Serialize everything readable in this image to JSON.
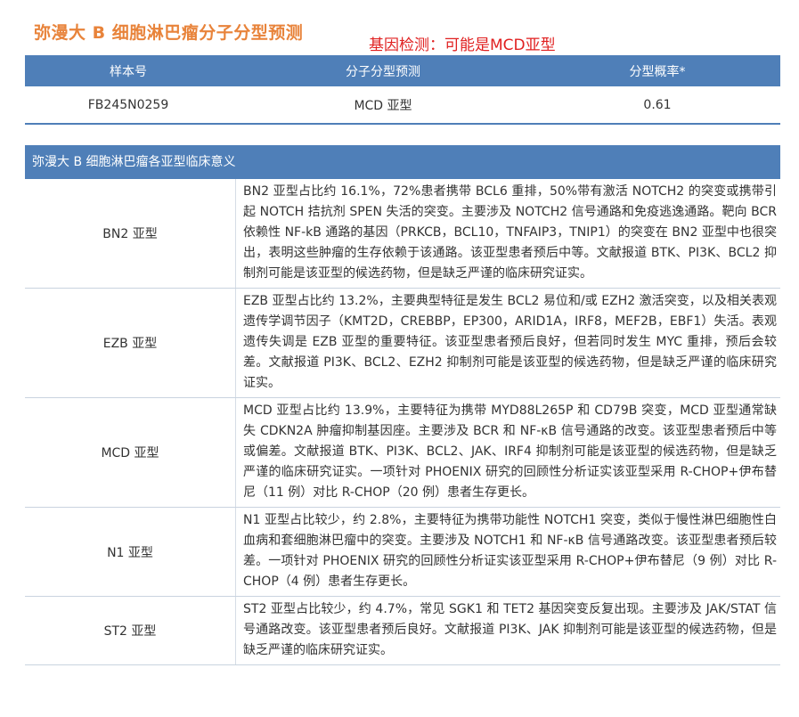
{
  "header": {
    "title": "弥漫大 B 细胞淋巴瘤分子分型预测",
    "gene_note": "基因检测：可能是MCD亚型"
  },
  "prediction_table": {
    "columns": [
      "样本号",
      "分子分型预测",
      "分型概率*"
    ],
    "row": [
      "FB245N0259",
      "MCD 亚型",
      "0.61"
    ]
  },
  "clinical": {
    "title": "弥漫大 B 细胞淋巴瘤各亚型临床意义",
    "rows": [
      {
        "type": "BN2 亚型",
        "desc": "BN2 亚型占比约 16.1%，72%患者携带 BCL6 重排，50%带有激活 NOTCH2 的突变或携带引起 NOTCH 拮抗剂 SPEN 失活的突变。主要涉及 NOTCH2 信号通路和免疫逃逸通路。靶向 BCR 依赖性 NF-kB 通路的基因（PRKCB，BCL10，TNFAIP3，TNIP1）的突变在 BN2 亚型中也很突出，表明这些肿瘤的生存依赖于该通路。该亚型患者预后中等。文献报道 BTK、PI3K、BCL2 抑制剂可能是该亚型的候选药物，但是缺乏严谨的临床研究证实。"
      },
      {
        "type": "EZB 亚型",
        "desc": "EZB 亚型占比约 13.2%，主要典型特征是发生 BCL2 易位和/或 EZH2 激活突变，以及相关表观遗传学调节因子（KMT2D，CREBBP，EP300，ARID1A，IRF8，MEF2B，EBF1）失活。表观遗传失调是 EZB 亚型的重要特征。该亚型患者预后良好，但若同时发生 MYC 重排，预后会较差。文献报道 PI3K、BCL2、EZH2 抑制剂可能是该亚型的候选药物，但是缺乏严谨的临床研究证实。"
      },
      {
        "type": "MCD 亚型",
        "desc": "MCD 亚型占比约 13.9%，主要特征为携带 MYD88L265P 和 CD79B 突变，MCD 亚型通常缺失 CDKN2A 肿瘤抑制基因座。主要涉及 BCR 和 NF-κB 信号通路的改变。该亚型患者预后中等或偏差。文献报道 BTK、PI3K、BCL2、JAK、IRF4 抑制剂可能是该亚型的候选药物，但是缺乏严谨的临床研究证实。一项针对 PHOENIX 研究的回顾性分析证实该亚型采用 R-CHOP+伊布替尼（11 例）对比 R-CHOP（20 例）患者生存更长。"
      },
      {
        "type": "N1 亚型",
        "desc": "N1 亚型占比较少，约 2.8%，主要特征为携带功能性 NOTCH1 突变，类似于慢性淋巴细胞性白血病和套细胞淋巴瘤中的突变。主要涉及 NOTCH1 和 NF-κB 信号通路改变。该亚型患者预后较差。一项针对 PHOENIX 研究的回顾性分析证实该亚型采用 R-CHOP+伊布替尼（9 例）对比 R-CHOP（4 例）患者生存更长。"
      },
      {
        "type": "ST2 亚型",
        "desc": "ST2 亚型占比较少，约 4.7%，常见 SGK1 和 TET2 基因突变反复出现。主要涉及 JAK/STAT 信号通路改变。该亚型患者预后良好。文献报道 PI3K、JAK 抑制剂可能是该亚型的候选药物，但是缺乏严谨的临床研究证实。"
      }
    ]
  }
}
